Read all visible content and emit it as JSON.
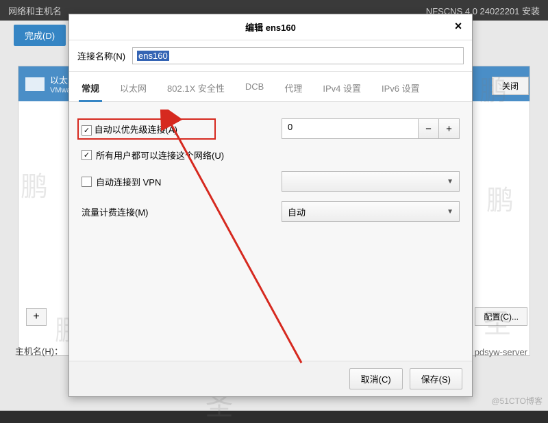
{
  "bg": {
    "topbar_left": "网络和主机名",
    "topbar_right": "NFSCNS 4.0 24022201 安装",
    "done_btn": "完成(D)",
    "ethernet_title": "以太",
    "ethernet_sub": "VMwa",
    "close_btn": "关闭",
    "add_btn": "+",
    "config_btn": "配置(C)...",
    "hostname_label": "主机名(H)：",
    "hostname_value": "pdsyw-server"
  },
  "dialog": {
    "title": "编辑 ens160",
    "conn_label": "连接名称(N)",
    "conn_value": "ens160",
    "tabs": [
      "常规",
      "以太网",
      "802.1X 安全性",
      "DCB",
      "代理",
      "IPv4 设置",
      "IPv6 设置"
    ],
    "active_tab": 0,
    "chk_auto": "自动以优先级连接(A)",
    "chk_allusers": "所有用户都可以连接这个网络(U)",
    "chk_vpn": "自动连接到 VPN",
    "label_metered": "流量计费连接(M)",
    "priority_value": "0",
    "vpn_value": "",
    "metered_value": "自动",
    "cancel_btn": "取消(C)",
    "save_btn": "保存(S)"
  },
  "watermark": "鹏 大 圣",
  "wm_chars": [
    "鹏",
    "大",
    "圣"
  ],
  "blog_watermark": "@51CTO博客"
}
